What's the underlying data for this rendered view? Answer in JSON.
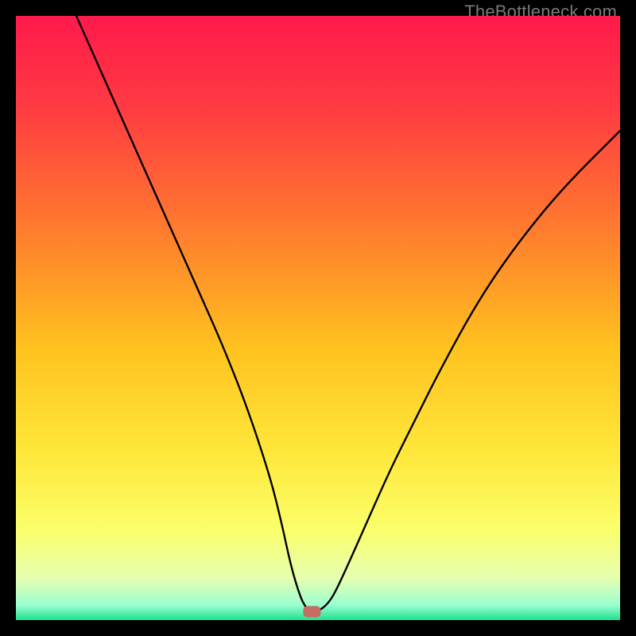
{
  "watermark": "TheBottleneck.com",
  "chart_data": {
    "type": "line",
    "title": "",
    "xlabel": "",
    "ylabel": "",
    "xlim": [
      0,
      100
    ],
    "ylim": [
      0,
      100
    ],
    "series": [
      {
        "name": "curve",
        "x": [
          10,
          14,
          18,
          22,
          26,
          30,
          34,
          38,
          42,
          44,
          45.5,
          47,
          48,
          49,
          50,
          52,
          54,
          58,
          62,
          66,
          70,
          76,
          82,
          90,
          100
        ],
        "y": [
          100,
          91,
          82,
          73,
          64,
          55,
          46,
          36,
          24,
          16,
          9,
          4,
          2,
          1.4,
          1.4,
          3,
          7,
          16,
          25,
          33,
          41,
          52,
          61,
          71,
          81
        ]
      }
    ],
    "marker": {
      "x": 49,
      "y": 1.4,
      "color": "#c76a62"
    },
    "gradient_stops": [
      {
        "offset": 0.0,
        "color": "#ff1a4b"
      },
      {
        "offset": 0.15,
        "color": "#ff3a42"
      },
      {
        "offset": 0.35,
        "color": "#ff7a2e"
      },
      {
        "offset": 0.55,
        "color": "#ffc21f"
      },
      {
        "offset": 0.72,
        "color": "#ffe73a"
      },
      {
        "offset": 0.85,
        "color": "#fbff6a"
      },
      {
        "offset": 0.93,
        "color": "#e7ffb0"
      },
      {
        "offset": 0.975,
        "color": "#9bffcf"
      },
      {
        "offset": 1.0,
        "color": "#1fe08f"
      }
    ]
  }
}
